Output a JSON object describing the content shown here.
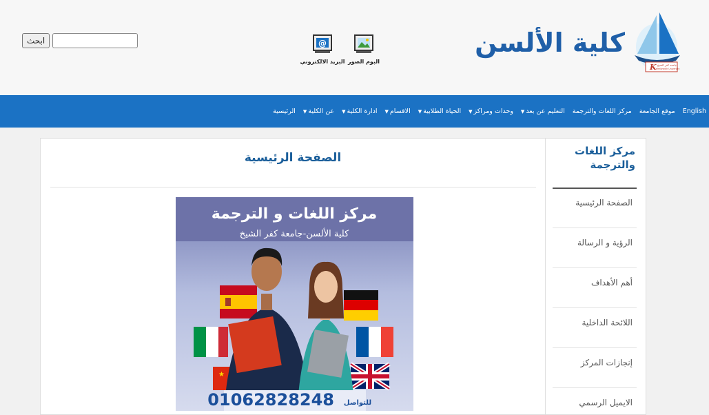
{
  "header": {
    "search_button": "ابحث",
    "quick_links": [
      {
        "label": "البوم الصور",
        "icon": "photo-album-icon"
      },
      {
        "label": "البريد الالكتروني",
        "icon": "email-icon"
      }
    ],
    "logo_text": "كلية الألسن",
    "logo_badge_line1": "جامعة كفر الشيخ",
    "logo_badge_line2": "Kafrelsheikh University"
  },
  "nav": {
    "items": [
      {
        "label": "الرئيسية",
        "dropdown": false
      },
      {
        "label": "عن الكلية",
        "dropdown": true
      },
      {
        "label": "ادارة الكلية",
        "dropdown": true
      },
      {
        "label": "الاقسام",
        "dropdown": true
      },
      {
        "label": "الحياة الطلابية",
        "dropdown": true
      },
      {
        "label": "وحدات ومراكز",
        "dropdown": true
      },
      {
        "label": "التعليم عن بعد",
        "dropdown": true
      },
      {
        "label": "مركز اللغات والترجمة",
        "dropdown": false
      },
      {
        "label": "موقع الجامعة",
        "dropdown": false
      },
      {
        "label": "English",
        "dropdown": false
      }
    ]
  },
  "main": {
    "title": "الصفحة الرئيسية",
    "poster": {
      "title": "مركز اللغات و الترجمة",
      "subtitle": "كلية الألسن-جامعة كفر الشيخ",
      "phone": "01062828248",
      "phone_label": "للتواصل"
    }
  },
  "sidebar": {
    "heading": "مركز اللغات والترجمة",
    "items": [
      "الصفحة الرئيسية",
      "الرؤية و الرسالة",
      "أهم الأهداف",
      "اللائحة الداخلية",
      "إنجازات المركز",
      "الايميل الرسمي"
    ]
  },
  "colors": {
    "nav_bg": "#1b72c4",
    "title": "#1a5e9a",
    "logo": "#1f5fa8"
  }
}
